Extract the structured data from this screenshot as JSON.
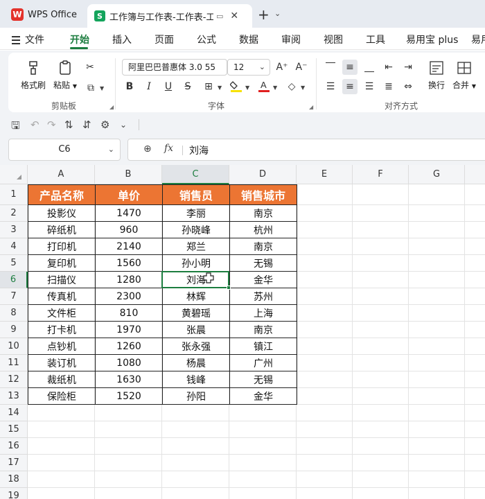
{
  "titlebar": {
    "wps_tab": "WPS Office",
    "wps_logo": "W",
    "doc_tab": "工作簿与工作表-工作表-工作",
    "doc_logo": "S",
    "new_tab": "+",
    "new_tab_dropdown": "⌄"
  },
  "menu": {
    "file": "文件",
    "items": [
      "开始",
      "插入",
      "页面",
      "公式",
      "数据",
      "审阅",
      "视图",
      "工具",
      "易用宝 plus",
      "易用"
    ],
    "active": "开始",
    "accent_color": "#1c7d3f"
  },
  "ribbon": {
    "clipboard": {
      "format_painter": "格式刷",
      "paste": "粘贴",
      "group_label": "剪贴板"
    },
    "font": {
      "font_name": "阿里巴巴普惠体 3.0 55",
      "font_size": "12",
      "group_label": "字体",
      "bold": "B",
      "italic": "I",
      "underline": "U",
      "strike": "S"
    },
    "align": {
      "wrap": "换行",
      "merge": "合并",
      "group_label": "对齐方式"
    }
  },
  "formula_bar": {
    "name_box": "C6",
    "fx": "fx",
    "value": "刘海"
  },
  "grid": {
    "columns": [
      "A",
      "B",
      "C",
      "D",
      "E",
      "F",
      "G"
    ],
    "selected_column": "C",
    "rows": [
      "1",
      "2",
      "3",
      "4",
      "5",
      "6",
      "7",
      "8",
      "9",
      "10",
      "11",
      "12",
      "13",
      "14",
      "15",
      "16",
      "17",
      "18",
      "19"
    ],
    "selected_row": "6",
    "header_color": "#ec7533"
  },
  "table": {
    "headers": [
      "产品名称",
      "单价",
      "销售员",
      "销售城市"
    ],
    "rows": [
      [
        "投影仪",
        "1470",
        "李丽",
        "南京"
      ],
      [
        "碎纸机",
        "960",
        "孙晓峰",
        "杭州"
      ],
      [
        "打印机",
        "2140",
        "郑兰",
        "南京"
      ],
      [
        "复印机",
        "1560",
        "孙小明",
        "无锡"
      ],
      [
        "扫描仪",
        "1280",
        "刘海",
        "金华"
      ],
      [
        "传真机",
        "2300",
        "林辉",
        "苏州"
      ],
      [
        "文件柜",
        "810",
        "黄碧瑶",
        "上海"
      ],
      [
        "打卡机",
        "1970",
        "张晨",
        "南京"
      ],
      [
        "点钞机",
        "1260",
        "张永强",
        "镇江"
      ],
      [
        "装订机",
        "1080",
        "杨晨",
        "广州"
      ],
      [
        "裁纸机",
        "1630",
        "钱峰",
        "无锡"
      ],
      [
        "保险柜",
        "1520",
        "孙阳",
        "金华"
      ]
    ]
  }
}
